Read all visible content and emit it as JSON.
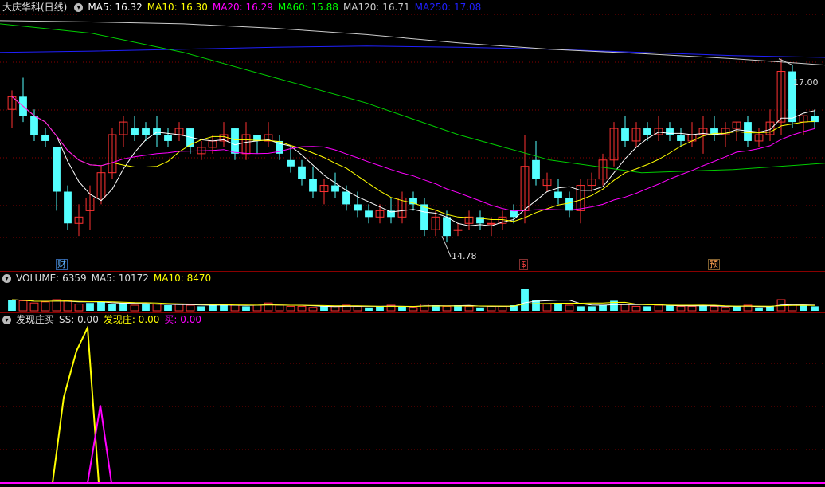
{
  "main_panel": {
    "stock_title": "大庆华科(日线)",
    "ma": [
      {
        "label": "MA5: 16.32",
        "color": "#ffffff"
      },
      {
        "label": "MA10: 16.30",
        "color": "#ffff00"
      },
      {
        "label": "MA20: 16.29",
        "color": "#ff00ff"
      },
      {
        "label": "MA60: 15.88",
        "color": "#00ff00"
      },
      {
        "label": "MA120: 16.71",
        "color": "#cccccc"
      },
      {
        "label": "MA250: 17.08",
        "color": "#2020ff"
      }
    ],
    "high_label": "17.00",
    "low_label": "14.78",
    "markers": [
      {
        "text": "财",
        "color": "#5fb0ff"
      },
      {
        "text": "$",
        "color": "#ff4040"
      },
      {
        "text": "预",
        "color": "#ffa050"
      }
    ]
  },
  "volume_panel": {
    "title": "VOLUME: 6359",
    "ma5": "MA5: 10172",
    "ma10": "MA10: 8470"
  },
  "indicator_panel": {
    "title": "发现庄买",
    "ss": "SS: 0.00",
    "zhuang": "发现庄: 0.00",
    "buy": "买: 0.00"
  },
  "colors": {
    "up": "#ff3232",
    "down": "#54ffff",
    "bg": "#000000",
    "grid": "#8a0000"
  },
  "chart_data": {
    "type": "candlestick",
    "ohlc": [
      [
        16.2,
        16.5,
        15.9,
        16.4
      ],
      [
        16.4,
        16.7,
        16.0,
        16.1
      ],
      [
        16.1,
        16.2,
        15.7,
        15.8
      ],
      [
        15.8,
        15.9,
        15.6,
        15.7
      ],
      [
        15.6,
        15.6,
        14.6,
        14.9
      ],
      [
        14.9,
        15.0,
        14.3,
        14.4
      ],
      [
        14.4,
        14.7,
        14.2,
        14.5
      ],
      [
        14.6,
        15.0,
        14.3,
        14.8
      ],
      [
        14.8,
        15.3,
        14.7,
        15.2
      ],
      [
        15.2,
        15.9,
        15.1,
        15.8
      ],
      [
        15.8,
        16.1,
        15.6,
        16.0
      ],
      [
        15.9,
        16.1,
        15.7,
        15.8
      ],
      [
        15.9,
        16.0,
        15.7,
        15.8
      ],
      [
        15.9,
        16.1,
        15.6,
        15.8
      ],
      [
        15.8,
        15.9,
        15.6,
        15.7
      ],
      [
        15.8,
        16.0,
        15.7,
        15.9
      ],
      [
        15.9,
        15.9,
        15.5,
        15.6
      ],
      [
        15.5,
        15.7,
        15.4,
        15.6
      ],
      [
        15.6,
        15.8,
        15.5,
        15.7
      ],
      [
        15.7,
        16.0,
        15.6,
        15.8
      ],
      [
        15.9,
        15.9,
        15.4,
        15.5
      ],
      [
        15.5,
        16.0,
        15.4,
        15.8
      ],
      [
        15.8,
        15.8,
        15.5,
        15.7
      ],
      [
        15.7,
        16.0,
        15.6,
        15.8
      ],
      [
        15.7,
        15.8,
        15.4,
        15.5
      ],
      [
        15.4,
        15.6,
        15.2,
        15.3
      ],
      [
        15.3,
        15.4,
        15.0,
        15.1
      ],
      [
        15.1,
        15.3,
        14.8,
        14.9
      ],
      [
        14.9,
        15.1,
        14.7,
        15.0
      ],
      [
        15.0,
        15.2,
        14.8,
        14.9
      ],
      [
        14.9,
        15.0,
        14.6,
        14.7
      ],
      [
        14.7,
        14.9,
        14.5,
        14.6
      ],
      [
        14.6,
        14.7,
        14.4,
        14.5
      ],
      [
        14.5,
        14.7,
        14.4,
        14.6
      ],
      [
        14.6,
        14.8,
        14.4,
        14.5
      ],
      [
        14.5,
        14.9,
        14.4,
        14.8
      ],
      [
        14.8,
        14.9,
        14.6,
        14.7
      ],
      [
        14.7,
        14.8,
        14.2,
        14.3
      ],
      [
        14.3,
        14.6,
        14.2,
        14.5
      ],
      [
        14.5,
        14.6,
        14.1,
        14.2
      ],
      [
        14.3,
        14.4,
        14.2,
        14.3
      ],
      [
        14.4,
        14.6,
        14.3,
        14.5
      ],
      [
        14.5,
        14.6,
        14.3,
        14.4
      ],
      [
        14.4,
        14.5,
        14.2,
        14.4
      ],
      [
        14.4,
        14.6,
        14.3,
        14.5
      ],
      [
        14.6,
        14.7,
        14.4,
        14.5
      ],
      [
        14.6,
        15.8,
        14.4,
        15.3
      ],
      [
        15.4,
        15.7,
        15.0,
        15.1
      ],
      [
        15.0,
        15.2,
        14.9,
        15.1
      ],
      [
        14.9,
        15.1,
        14.7,
        14.8
      ],
      [
        14.8,
        14.9,
        14.5,
        14.6
      ],
      [
        14.6,
        15.1,
        14.4,
        15.0
      ],
      [
        15.0,
        15.2,
        14.9,
        15.1
      ],
      [
        15.1,
        15.5,
        15.0,
        15.4
      ],
      [
        15.4,
        16.0,
        15.3,
        15.9
      ],
      [
        15.9,
        16.1,
        15.6,
        15.7
      ],
      [
        15.7,
        16.0,
        15.6,
        15.9
      ],
      [
        15.9,
        16.0,
        15.7,
        15.8
      ],
      [
        15.8,
        16.1,
        15.7,
        15.9
      ],
      [
        15.9,
        16.0,
        15.7,
        15.8
      ],
      [
        15.8,
        15.9,
        15.6,
        15.7
      ],
      [
        15.7,
        16.0,
        15.6,
        15.8
      ],
      [
        15.8,
        16.1,
        15.5,
        15.9
      ],
      [
        15.9,
        16.1,
        15.7,
        15.8
      ],
      [
        15.8,
        16.0,
        15.6,
        15.9
      ],
      [
        15.9,
        16.0,
        15.7,
        16.0
      ],
      [
        16.0,
        16.1,
        15.6,
        15.7
      ],
      [
        15.7,
        15.9,
        15.6,
        15.8
      ],
      [
        15.8,
        16.2,
        15.7,
        16.0
      ],
      [
        16.0,
        17.0,
        15.8,
        16.8
      ],
      [
        16.8,
        16.9,
        15.9,
        16.0
      ],
      [
        16.0,
        16.1,
        15.8,
        16.1
      ],
      [
        16.1,
        16.2,
        15.9,
        16.0
      ]
    ],
    "volume": [
      [
        1.0,
        1
      ],
      [
        0.9,
        0
      ],
      [
        0.7,
        0
      ],
      [
        0.8,
        0
      ],
      [
        1.0,
        0
      ],
      [
        0.9,
        0
      ],
      [
        0.6,
        0
      ],
      [
        0.7,
        1
      ],
      [
        0.8,
        1
      ],
      [
        0.6,
        1
      ],
      [
        0.7,
        1
      ],
      [
        0.5,
        0
      ],
      [
        0.6,
        1
      ],
      [
        0.6,
        0
      ],
      [
        0.5,
        1
      ],
      [
        0.6,
        0
      ],
      [
        0.5,
        0
      ],
      [
        0.4,
        1
      ],
      [
        0.5,
        1
      ],
      [
        0.6,
        1
      ],
      [
        0.5,
        0
      ],
      [
        0.4,
        1
      ],
      [
        0.5,
        0
      ],
      [
        0.7,
        0
      ],
      [
        0.5,
        0
      ],
      [
        0.4,
        0
      ],
      [
        0.4,
        0
      ],
      [
        0.3,
        0
      ],
      [
        0.4,
        1
      ],
      [
        0.4,
        0
      ],
      [
        0.5,
        0
      ],
      [
        0.4,
        0
      ],
      [
        0.3,
        1
      ],
      [
        0.4,
        1
      ],
      [
        0.5,
        0
      ],
      [
        0.4,
        1
      ],
      [
        0.3,
        0
      ],
      [
        0.6,
        0
      ],
      [
        0.5,
        1
      ],
      [
        0.4,
        0
      ],
      [
        0.5,
        1
      ],
      [
        0.4,
        0
      ],
      [
        0.3,
        1
      ],
      [
        0.4,
        0
      ],
      [
        0.4,
        0
      ],
      [
        0.5,
        1
      ],
      [
        2.0,
        1
      ],
      [
        1.0,
        1
      ],
      [
        0.6,
        0
      ],
      [
        0.7,
        1
      ],
      [
        0.5,
        0
      ],
      [
        0.4,
        1
      ],
      [
        0.4,
        1
      ],
      [
        0.5,
        1
      ],
      [
        0.9,
        1
      ],
      [
        0.6,
        0
      ],
      [
        0.4,
        0
      ],
      [
        0.4,
        1
      ],
      [
        0.5,
        0
      ],
      [
        0.5,
        1
      ],
      [
        0.4,
        0
      ],
      [
        0.4,
        0
      ],
      [
        0.5,
        1
      ],
      [
        0.4,
        0
      ],
      [
        0.3,
        0
      ],
      [
        0.4,
        1
      ],
      [
        0.5,
        0
      ],
      [
        0.3,
        1
      ],
      [
        0.4,
        1
      ],
      [
        1.0,
        0
      ],
      [
        0.6,
        0
      ],
      [
        0.5,
        1
      ],
      [
        0.4,
        1
      ]
    ],
    "ma250_y": [
      17.1,
      17.12,
      17.15,
      17.18,
      17.2,
      17.18,
      17.15,
      17.1,
      17.05,
      17.02
    ],
    "ma120_y": [
      17.6,
      17.58,
      17.55,
      17.48,
      17.38,
      17.25,
      17.15,
      17.08,
      17.0,
      16.9
    ],
    "ma60_y": [
      17.55,
      17.4,
      17.1,
      16.7,
      16.3,
      15.8,
      15.4,
      15.2,
      15.25,
      15.35
    ],
    "ss_series": [
      0,
      0,
      0,
      0,
      0.55,
      0.85,
      1.0,
      0,
      0,
      0
    ],
    "buy_series": [
      0,
      0,
      0,
      0,
      0,
      0,
      0,
      0.5,
      0,
      0
    ]
  }
}
